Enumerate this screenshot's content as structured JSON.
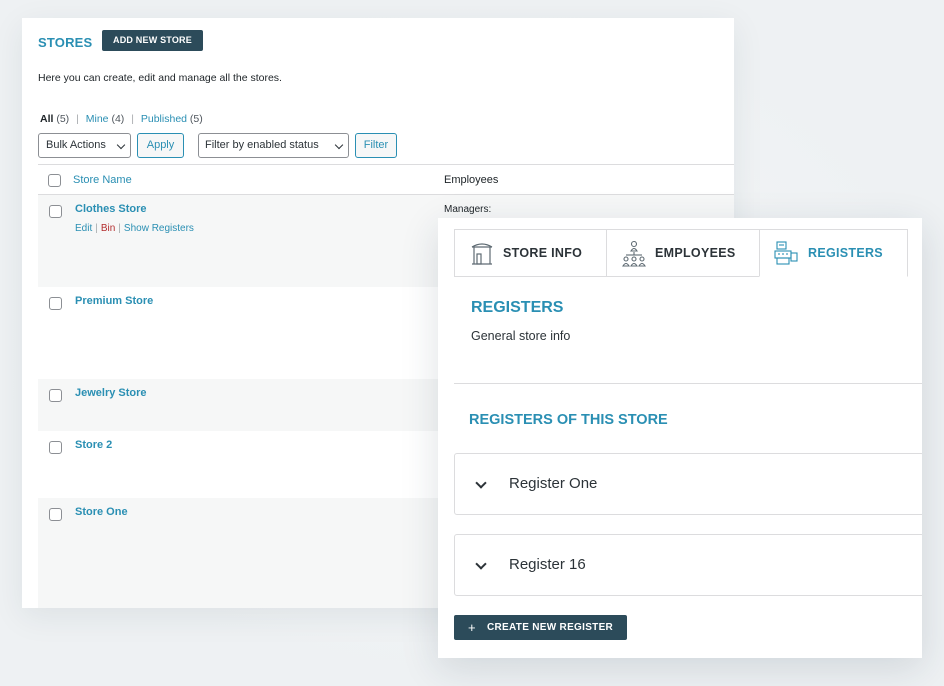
{
  "stores_panel": {
    "title": "STORES",
    "add_button": "ADD NEW STORE",
    "description": "Here you can create, edit and manage all the stores.",
    "views": {
      "all": "All",
      "all_count": "(5)",
      "mine": "Mine",
      "mine_count": "(4)",
      "published": "Published",
      "published_count": "(5)"
    },
    "bulk_actions": "Bulk Actions",
    "apply": "Apply",
    "filter_select": "Filter by enabled status",
    "filter": "Filter",
    "columns": {
      "name": "Store Name",
      "employees": "Employees"
    },
    "rows": [
      {
        "name": "Clothes Store",
        "managers": "Managers:",
        "actions": {
          "edit": "Edit",
          "bin": "Bin",
          "show_registers": "Show Registers"
        }
      },
      {
        "name": "Premium Store"
      },
      {
        "name": "Jewelry Store"
      },
      {
        "name": "Store 2"
      },
      {
        "name": "Store One"
      }
    ]
  },
  "detail_panel": {
    "tabs": [
      {
        "label": "STORE INFO",
        "icon": "store-icon"
      },
      {
        "label": "EMPLOYEES",
        "icon": "employees-icon"
      },
      {
        "label": "REGISTERS",
        "icon": "register-icon"
      }
    ],
    "active_tab": "REGISTERS",
    "section_title": "REGISTERS",
    "section_description": "General store info",
    "registers_title": "REGISTERS OF THIS STORE",
    "registers": [
      {
        "name": "Register One"
      },
      {
        "name": "Register 16"
      }
    ],
    "create_button": "CREATE NEW REGISTER",
    "create_button_icon": "+"
  },
  "colors": {
    "accent": "#2a8fb3",
    "dark_button": "#2c4b5a",
    "danger": "#b32d2e",
    "background": "#eef1f3"
  }
}
